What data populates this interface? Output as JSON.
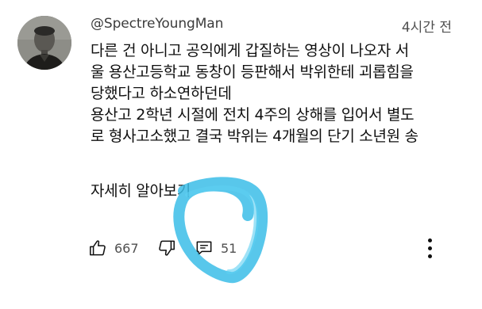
{
  "comment": {
    "author": "@SpectreYoungMan",
    "time": "4시간 전",
    "text_lines": [
      "다른 건 아니고 공익에게 갑질하는 영상이 나오자 서",
      "울 용산고등학교 동창이 등판해서 박위한테 괴롭힘을",
      "당했다고 하소연하던데",
      "용산고 2학년 시절에 전치 4주의 상해를 입어서 별도",
      "로 형사고소했고 결국 박위는 4개월의 단기 소년원 송"
    ],
    "read_more": "자세히 알아보기",
    "like_count": "667",
    "reply_count": "51"
  },
  "icons": {
    "avatar": "avatar-photo",
    "like": "thumbs-up-icon",
    "dislike": "thumbs-down-icon",
    "reply": "comment-bubble-icon",
    "menu": "more-vertical-icon"
  },
  "colors": {
    "text": "#0f0f0f",
    "secondary_text": "#505050",
    "highlight_scribble": "#3bbde8"
  }
}
